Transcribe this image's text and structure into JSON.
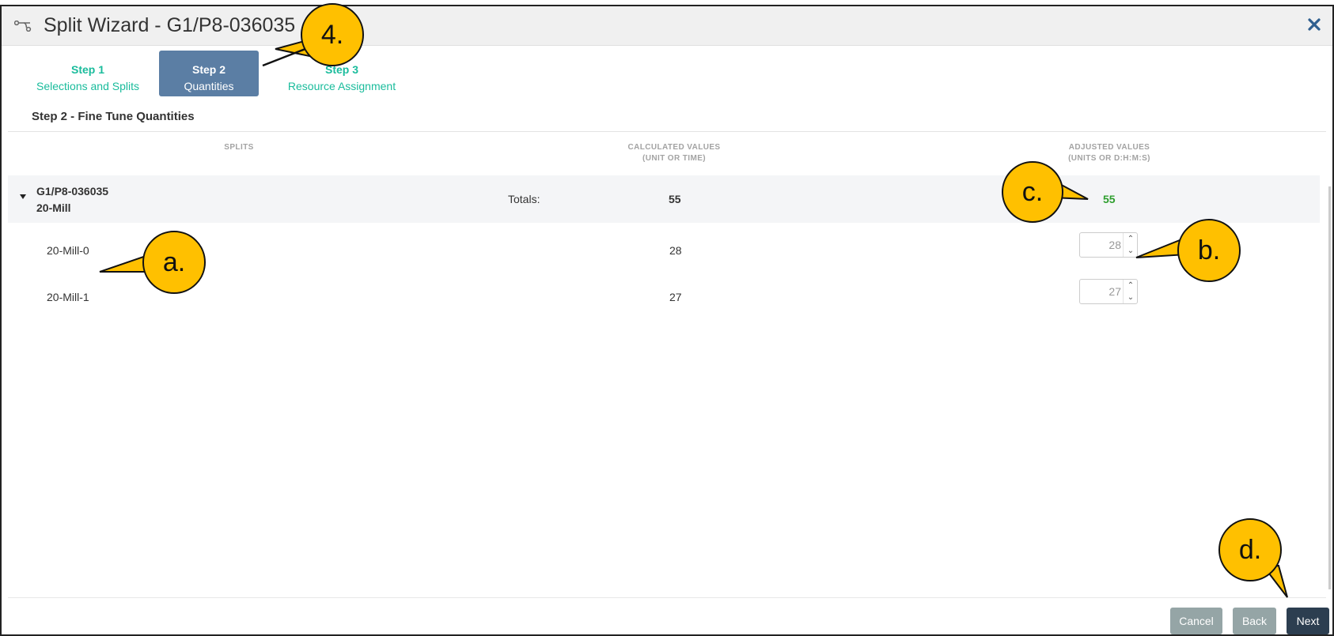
{
  "window": {
    "title": "Split Wizard - G1/P8-036035",
    "close_icon": "close-icon"
  },
  "steps": [
    {
      "num": "Step 1",
      "label": "Selections and Splits"
    },
    {
      "num": "Step 2",
      "label": "Quantities"
    },
    {
      "num": "Step 3",
      "label": "Resource Assignment"
    }
  ],
  "section_title": "Step 2 - Fine Tune Quantities",
  "columns": {
    "splits": "SPLITS",
    "calculated_line1": "CALCULATED VALUES",
    "calculated_line2": "(UNIT OR TIME)",
    "adjusted_line1": "ADJUSTED VALUES",
    "adjusted_line2": "(UNITS OR D:H:M:S)"
  },
  "group": {
    "order": "G1/P8-036035",
    "operation": "20-Mill",
    "totals_label": "Totals:",
    "totals_calculated": "55",
    "totals_adjusted": "55"
  },
  "splits": [
    {
      "name": "20-Mill-0",
      "calculated": "28",
      "adjusted": "28"
    },
    {
      "name": "20-Mill-1",
      "calculated": "27",
      "adjusted": "27"
    }
  ],
  "buttons": {
    "cancel": "Cancel",
    "back": "Back",
    "next": "Next"
  },
  "callouts": {
    "a": "a.",
    "b": "b.",
    "c": "c.",
    "d": "d.",
    "four": "4."
  },
  "colors": {
    "accent": "#1abc9c",
    "active_step": "#5b7ea4",
    "totals_green": "#2e9e2e",
    "callout_fill": "#ffc000",
    "primary_button": "#2c3e50",
    "secondary_button": "#95a5a6"
  }
}
